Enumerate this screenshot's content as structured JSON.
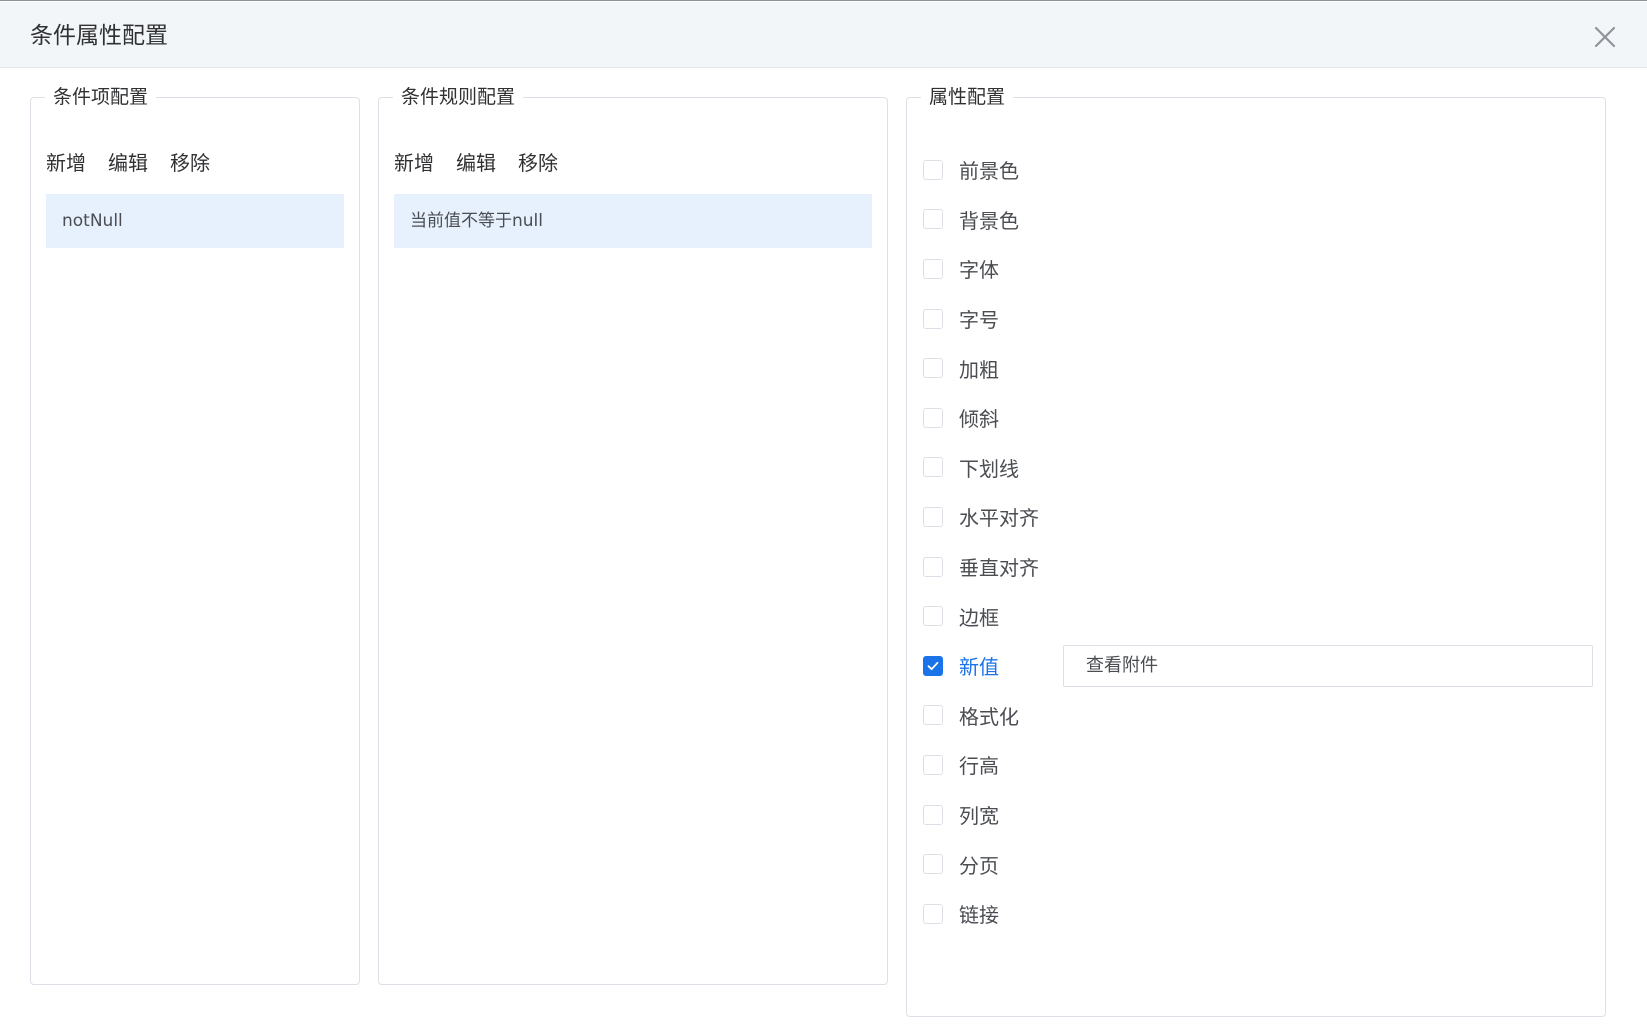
{
  "dialog": {
    "title": "条件属性配置"
  },
  "condition_items": {
    "legend": "条件项配置",
    "toolbar": {
      "add": "新增",
      "edit": "编辑",
      "remove": "移除"
    },
    "items": [
      "notNull"
    ]
  },
  "condition_rules": {
    "legend": "条件规则配置",
    "toolbar": {
      "add": "新增",
      "edit": "编辑",
      "remove": "移除"
    },
    "items": [
      "当前值不等于null"
    ]
  },
  "attributes": {
    "legend": "属性配置",
    "items": [
      {
        "label": "前景色",
        "checked": false
      },
      {
        "label": "背景色",
        "checked": false
      },
      {
        "label": "字体",
        "checked": false
      },
      {
        "label": "字号",
        "checked": false
      },
      {
        "label": "加粗",
        "checked": false
      },
      {
        "label": "倾斜",
        "checked": false
      },
      {
        "label": "下划线",
        "checked": false
      },
      {
        "label": "水平对齐",
        "checked": false
      },
      {
        "label": "垂直对齐",
        "checked": false
      },
      {
        "label": "边框",
        "checked": false
      },
      {
        "label": "新值",
        "checked": true,
        "value": "查看附件"
      },
      {
        "label": "格式化",
        "checked": false
      },
      {
        "label": "行高",
        "checked": false
      },
      {
        "label": "列宽",
        "checked": false
      },
      {
        "label": "分页",
        "checked": false
      },
      {
        "label": "链接",
        "checked": false
      }
    ]
  },
  "colors": {
    "accent": "#1a73e8",
    "selected_row": "#e7f1fd",
    "header_bg": "#f3f6f9"
  }
}
